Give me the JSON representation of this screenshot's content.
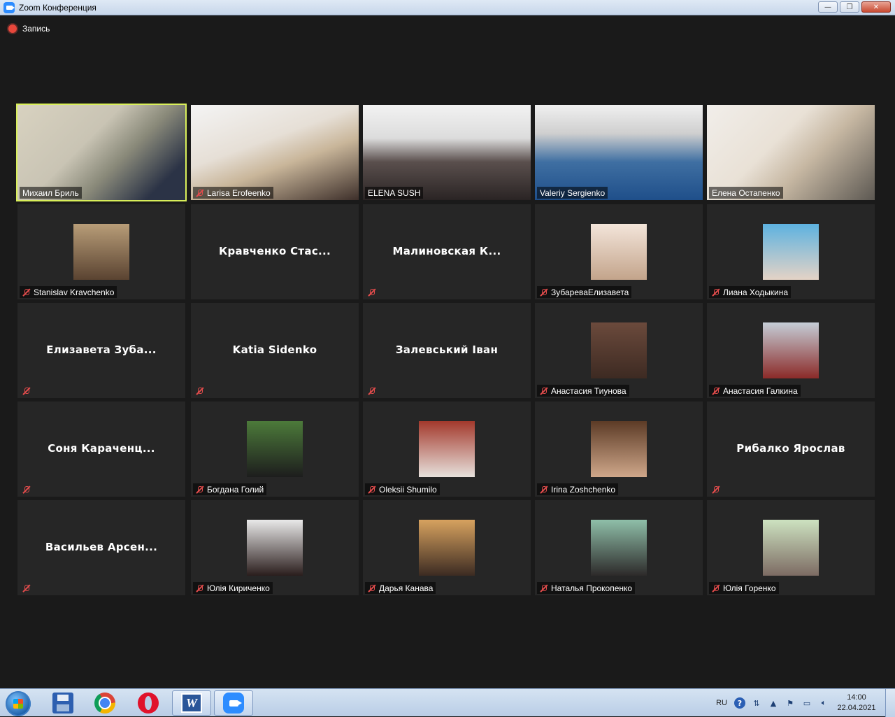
{
  "window": {
    "title": "Zoom Конференция",
    "controls": [
      "—",
      "❐",
      "✕"
    ]
  },
  "recording": {
    "label": "Запись"
  },
  "participants": [
    {
      "name": "Михаил Бриль",
      "kind": "video",
      "active": true,
      "muted": false
    },
    {
      "name": "Larisa Erofeenko",
      "kind": "video",
      "muted": true
    },
    {
      "name": "ELENA SUSH",
      "kind": "video",
      "muted": false
    },
    {
      "name": "Valeriy Sergienko",
      "kind": "video",
      "muted": false
    },
    {
      "name": "Елена Остапенко",
      "kind": "video",
      "muted": false
    },
    {
      "name": "Stanislav Kravchenko",
      "kind": "avatar",
      "muted": true
    },
    {
      "center": "Кравченко Стас...",
      "kind": "text",
      "muted": false
    },
    {
      "center": "Малиновская К...",
      "kind": "text",
      "muted": true
    },
    {
      "name": "ЗубареваЕлизавета",
      "kind": "avatar",
      "muted": true
    },
    {
      "name": "Лиана Ходыкина",
      "kind": "avatar",
      "muted": true
    },
    {
      "center": "Елизавета Зуба...",
      "kind": "text",
      "muted": true
    },
    {
      "center": "Katia Sidenko",
      "kind": "text",
      "muted": true
    },
    {
      "center": "Залевський Іван",
      "kind": "text",
      "muted": true
    },
    {
      "name": "Анастасия Тиунова",
      "kind": "avatar",
      "muted": true
    },
    {
      "name": "Анастасия Галкина",
      "kind": "avatar",
      "muted": true
    },
    {
      "center": "Соня Караченц...",
      "kind": "text",
      "muted": true
    },
    {
      "name": "Богдана Голий",
      "kind": "avatar",
      "muted": true
    },
    {
      "name": "Oleksii Shumilo",
      "kind": "avatar",
      "muted": true
    },
    {
      "name": "Irina Zoshchenko",
      "kind": "avatar",
      "muted": true
    },
    {
      "center": "Рибалко Ярослав",
      "kind": "text",
      "muted": true
    },
    {
      "center": "Васильев Арсен...",
      "kind": "text",
      "muted": true
    },
    {
      "name": "Юлія Кириченко",
      "kind": "avatar",
      "muted": true
    },
    {
      "name": "Дарья Канава",
      "kind": "avatar",
      "muted": true
    },
    {
      "name": "Наталья Прокопенко",
      "kind": "avatar",
      "muted": true
    },
    {
      "name": "Юлія Горенко",
      "kind": "avatar",
      "muted": true
    }
  ],
  "taskbar": {
    "apps": [
      "save-app-icon",
      "chrome-icon",
      "opera-icon",
      "word-icon",
      "zoom-icon"
    ],
    "tray": {
      "lang": "RU",
      "time": "14:00",
      "date": "22.04.2021"
    }
  }
}
